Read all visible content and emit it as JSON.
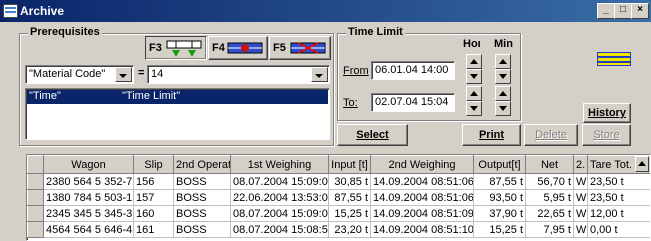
{
  "window": {
    "title": "Archive",
    "minimize": "_",
    "maximize": "□",
    "close": "×"
  },
  "prerequisites": {
    "label": "Prerequisites",
    "f3_label": "F3",
    "f4_label": "F4",
    "f5_label": "F5",
    "field_select": "\"Material Code\"",
    "operator": "=",
    "value": "14",
    "list_rows": [
      {
        "col1": "\"Time\"",
        "col2": "\"Time Limit\""
      }
    ]
  },
  "time_limit": {
    "label": "Time Limit",
    "hour_label": "Hoι",
    "min_label": "Min",
    "from_label": "From",
    "from_value": "06.01.04 14:00",
    "to_label": "To:",
    "to_value": "02.07.04 15:04"
  },
  "buttons": {
    "select": "Select",
    "print": "Print",
    "delete": "Delete",
    "store": "Store",
    "history": "History"
  },
  "table": {
    "columns": [
      "",
      "Wagon",
      "Slip",
      "2nd Operato",
      "1st Weighing",
      "Input [t]",
      "2nd Weighing",
      "Output[t]",
      "Net",
      "2.",
      "Tare Tot."
    ],
    "rows": [
      [
        "",
        "2380 564 5 352-7",
        "156",
        "BOSS",
        "08.07.2004 15:09:06",
        "30,85 t",
        "14.09.2004 08:51:06",
        "87,55 t",
        "56,70 t",
        "W",
        "23,50 t"
      ],
      [
        "",
        "1380 784 5 503-1",
        "157",
        "BOSS",
        "22.06.2004 13:53:04",
        "87,55 t",
        "14.09.2004 08:51:06",
        "93,50 t",
        "5,95 t",
        "W",
        "23,50 t"
      ],
      [
        "",
        "2345 345 5 345-3",
        "160",
        "BOSS",
        "08.07.2004 15:09:04",
        "15,25 t",
        "14.09.2004 08:51:09",
        "37,90 t",
        "22,65 t",
        "W",
        "12,00 t"
      ],
      [
        "",
        "4564 564 5 646-4",
        "161",
        "BOSS",
        "08.07.2004 15:08:57",
        "23,20 t",
        "14.09.2004 08:51:10",
        "15,25 t",
        "7,95 t",
        "W",
        "0,00 t"
      ]
    ]
  },
  "colors": {
    "title_start": "#0a246a",
    "title_end": "#3a6ea5",
    "selection": "#0a246a",
    "flag_yellow": "#f5e400",
    "flag_blue": "#1f3fbf"
  }
}
